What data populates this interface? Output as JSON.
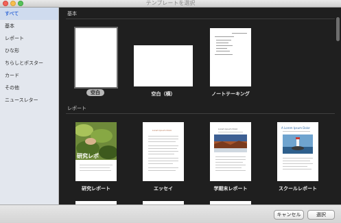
{
  "window": {
    "title": "テンプレートを選択"
  },
  "sidebar": {
    "items": [
      {
        "label": "すべて",
        "selected": true
      },
      {
        "label": "基本"
      },
      {
        "label": "レポート"
      },
      {
        "label": "ひな形"
      },
      {
        "label": "ちらしとポスター"
      },
      {
        "label": "カード"
      },
      {
        "label": "その他"
      },
      {
        "label": "ニュースレター"
      }
    ]
  },
  "sections": [
    {
      "header": "基本",
      "templates": [
        {
          "label": "空白",
          "selected": true
        },
        {
          "label": "空白（横）"
        },
        {
          "label": "ノートテーキング"
        }
      ]
    },
    {
      "header": "レポート",
      "templates": [
        {
          "label": "研究レポート",
          "thumb_title": "研究レポ"
        },
        {
          "label": "エッセイ",
          "thumb_title": "Lorem Ipsum Dolor"
        },
        {
          "label": "学期末レポート",
          "thumb_title": "Lorem Ipsum Dolor"
        },
        {
          "label": "スクールレポート",
          "thumb_title": "A Lorem Ipsum Dolor"
        }
      ]
    }
  ],
  "footer": {
    "cancel_label": "キャンセル",
    "select_label": "選択"
  },
  "colors": {
    "selection_text": "#3b6fd8",
    "content_bg": "#1f1f1f",
    "sidebar_bg": "#e3e7ee"
  }
}
